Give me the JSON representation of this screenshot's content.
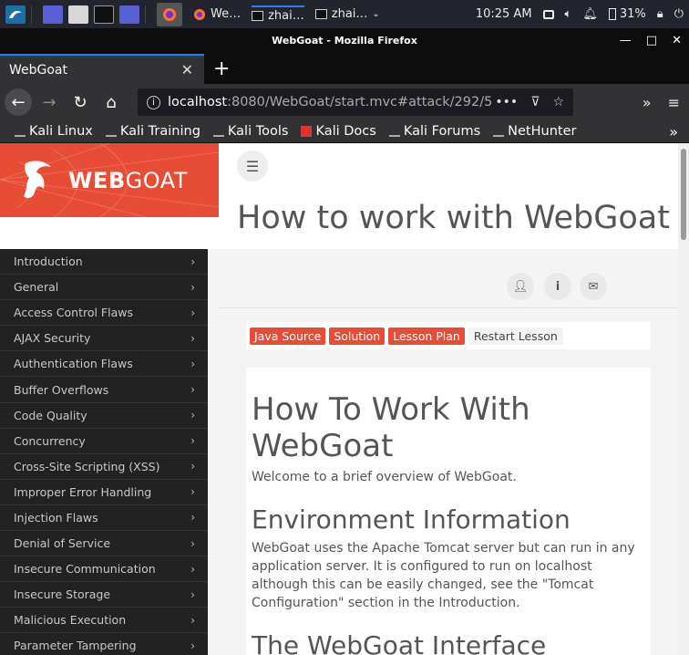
{
  "taskbar": {
    "tasks": [
      {
        "label": "We…"
      },
      {
        "label": "zhai…"
      },
      {
        "label": "zhai…"
      }
    ],
    "clock": "10:25 AM",
    "battery": "31%"
  },
  "window": {
    "title": "WebGoat - Mozilla Firefox"
  },
  "browser": {
    "tab_title": "WebGoat",
    "url_host": "localhost",
    "url_rest": ":8080/WebGoat/start.mvc#attack/292/5",
    "bookmarks": [
      "Kali Linux",
      "Kali Training",
      "Kali Tools",
      "Kali Docs",
      "Kali Forums",
      "NetHunter"
    ]
  },
  "app": {
    "logo_bold": "WEB",
    "logo_light": "GOAT",
    "page_title": "How to work with WebGoat",
    "sidebar": [
      "Introduction",
      "General",
      "Access Control Flaws",
      "AJAX Security",
      "Authentication Flaws",
      "Buffer Overflows",
      "Code Quality",
      "Concurrency",
      "Cross-Site Scripting (XSS)",
      "Improper Error Handling",
      "Injection Flaws",
      "Denial of Service",
      "Insecure Communication",
      "Insecure Storage",
      "Malicious Execution",
      "Parameter Tampering"
    ],
    "lesson_buttons": {
      "java_source": "Java Source",
      "solution": "Solution",
      "lesson_plan": "Lesson Plan",
      "restart": "Restart Lesson"
    },
    "lesson": {
      "heading": "How To Work With WebGoat",
      "welcome": "Welcome to a brief overview of WebGoat.",
      "env_heading": "Environment Information",
      "env_text": "WebGoat uses the Apache Tomcat server but can run in any application server. It is configured to run on localhost although this can be easily changed, see the \"Tomcat Configuration\" section in the Introduction.",
      "interface_heading": "The WebGoat Interface"
    }
  },
  "colors": {
    "accent": "#e74c35",
    "sidebar_bg": "#222222",
    "firefox_dark": "#323234"
  }
}
